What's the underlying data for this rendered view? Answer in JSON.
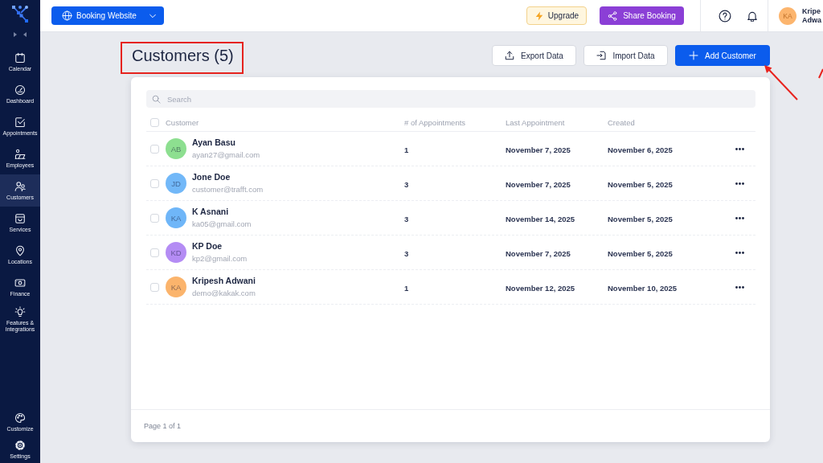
{
  "sidebar": {
    "items": [
      {
        "label": "Calendar",
        "selected": false
      },
      {
        "label": "Dashboard",
        "selected": false
      },
      {
        "label": "Appointments",
        "selected": false
      },
      {
        "label": "Employees",
        "selected": false
      },
      {
        "label": "Customers",
        "selected": true
      },
      {
        "label": "Services",
        "selected": false
      },
      {
        "label": "Locations",
        "selected": false
      },
      {
        "label": "Finance",
        "selected": false
      },
      {
        "label": "Features & Integrations",
        "selected": false
      }
    ],
    "bottom_items": [
      {
        "label": "Customize",
        "selected": false
      },
      {
        "label": "Settings",
        "selected": false
      }
    ]
  },
  "topbar": {
    "site_button": "Booking Website",
    "upgrade_button": "Upgrade",
    "share_button": "Share Booking",
    "user": {
      "initials": "KA",
      "name_lines": [
        "Kripe",
        "Adwa"
      ]
    }
  },
  "page": {
    "title": "Customers (5)",
    "actions": [
      {
        "label": "Export Data",
        "kind": "export"
      },
      {
        "label": "Import Data",
        "kind": "import"
      },
      {
        "label": "Add Customer",
        "kind": "add"
      }
    ]
  },
  "search": {
    "placeholder": "Search"
  },
  "table": {
    "select_all_checked": false,
    "columns": [
      "Customer",
      "# of Appointments",
      "Last Appointment",
      "Created"
    ],
    "rows": [
      {
        "checked": false,
        "initials": "AB",
        "color": "#8ddf90",
        "name": "Ayan Basu",
        "email": "ayan27@gmail.com",
        "appointments": "1",
        "last_appointment": "November 7, 2025",
        "created": "November 6, 2025"
      },
      {
        "checked": false,
        "initials": "JD",
        "color": "#72b8f8",
        "name": "Jone Doe",
        "email": "customer@trafft.com",
        "appointments": "3",
        "last_appointment": "November 7, 2025",
        "created": "November 5, 2025"
      },
      {
        "checked": false,
        "initials": "KA",
        "color": "#6fb6f8",
        "name": "K Asnani",
        "email": "ka05@gmail.com",
        "appointments": "3",
        "last_appointment": "November 14, 2025",
        "created": "November 5, 2025"
      },
      {
        "checked": false,
        "initials": "KD",
        "color": "#b48cf4",
        "name": "KP Doe",
        "email": "kp2@gmail.com",
        "appointments": "3",
        "last_appointment": "November 7, 2025",
        "created": "November 5, 2025"
      },
      {
        "checked": false,
        "initials": "KA",
        "color": "#fbb46c",
        "name": "Kripesh Adwani",
        "email": "demo@kakak.com",
        "appointments": "1",
        "last_appointment": "November 12, 2025",
        "created": "November 10, 2025"
      }
    ]
  },
  "pagination": "Page 1 of 1"
}
